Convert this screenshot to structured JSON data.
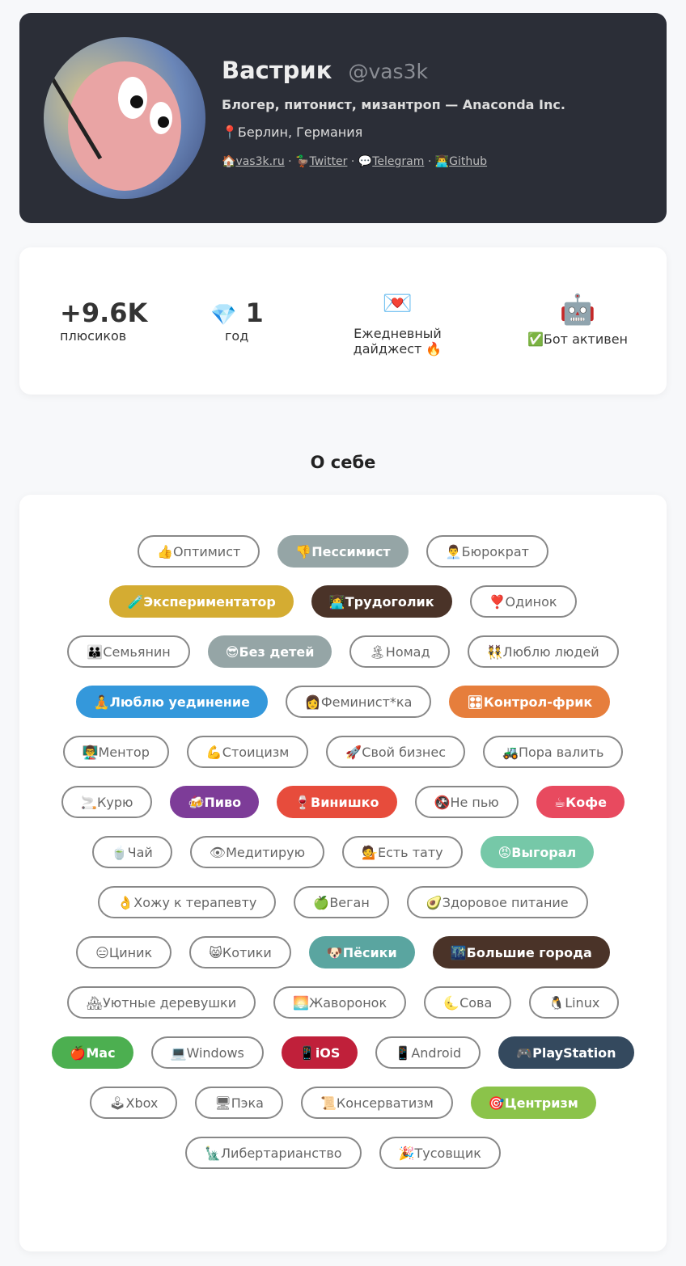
{
  "profile": {
    "name": "Вастрик",
    "handle": "@vas3k",
    "bio": "Блогер, питонист, мизантроп — Anaconda Inc.",
    "location": "📍Берлин, Германия",
    "links": [
      {
        "icon": "🏠",
        "label": "vas3k.ru"
      },
      {
        "icon": "🦆",
        "label": "Twitter"
      },
      {
        "icon": "💬",
        "label": "Telegram"
      },
      {
        "icon": "👨‍💻",
        "label": "Github"
      }
    ],
    "separator": "·"
  },
  "stats": {
    "upvotes": "+9.6K",
    "upvotes_label": "плюсиков",
    "years_icon": "💎",
    "years": "1",
    "years_label": "год",
    "digest_icon": "💌",
    "digest_label": "Ежедневный дайджест 🔥",
    "bot_icon": "🤖",
    "bot_label": "✅Бот активен"
  },
  "about_title": "О себе",
  "tags": [
    {
      "label": "👍Оптимист"
    },
    {
      "label": "👎Пессимист",
      "color": "#95a5a6"
    },
    {
      "label": "👨‍💼Бюрократ"
    },
    {
      "label": "🧪Экспериментатор",
      "color": "#d4ac32"
    },
    {
      "label": "👩‍💻Трудоголик",
      "color": "#4a3328"
    },
    {
      "label": "❣️Одинок"
    },
    {
      "label": "👪Семьянин"
    },
    {
      "label": "😎Без детей",
      "color": "#95a5a6"
    },
    {
      "label": "🏝Номад"
    },
    {
      "label": "👯Люблю людей"
    },
    {
      "label": "🧘Люблю уединение",
      "color": "#3498db"
    },
    {
      "label": "👩Феминист*ка"
    },
    {
      "label": "🎛Контрол-фрик",
      "color": "#e67e3c"
    },
    {
      "label": "👨‍🏫Ментор"
    },
    {
      "label": "💪Стоицизм"
    },
    {
      "label": "🚀Свой бизнес"
    },
    {
      "label": "🚜Пора валить"
    },
    {
      "label": "🚬Курю"
    },
    {
      "label": "🍻Пиво",
      "color": "#7d3c98"
    },
    {
      "label": "🍷Винишко",
      "color": "#e74c3c"
    },
    {
      "label": "🚱Не пью"
    },
    {
      "label": "☕Кофе",
      "color": "#e84a5f"
    },
    {
      "label": "🍵Чай"
    },
    {
      "label": "👁Медитирую"
    },
    {
      "label": "💁Есть тату"
    },
    {
      "label": "😡Выгорал",
      "color": "#76c8a8"
    },
    {
      "label": "👌Хожу к терапевту"
    },
    {
      "label": "🍏Веган"
    },
    {
      "label": "🥑Здоровое питание"
    },
    {
      "label": "😑Циник"
    },
    {
      "label": "😸Котики"
    },
    {
      "label": "🐶Пёсики",
      "color": "#5aa5a0"
    },
    {
      "label": "🌃Большие города",
      "color": "#4a3328"
    },
    {
      "label": "🏘Уютные деревушки"
    },
    {
      "label": "🌅Жаворонок"
    },
    {
      "label": "🌜Сова"
    },
    {
      "label": "🐧Linux"
    },
    {
      "label": "🍎Mac",
      "color": "#4caf50"
    },
    {
      "label": "💻Windows"
    },
    {
      "label": "📱iOS",
      "color": "#c0203a"
    },
    {
      "label": "📱Android"
    },
    {
      "label": "🎮PlayStation",
      "color": "#34495e"
    },
    {
      "label": "🕹Xbox"
    },
    {
      "label": "🖥Пэка"
    },
    {
      "label": "📜Консерватизм"
    },
    {
      "label": "🎯Центризм",
      "color": "#8bc34a"
    },
    {
      "label": "🗽Либертарианство"
    },
    {
      "label": "🎉Тусовщик"
    }
  ]
}
